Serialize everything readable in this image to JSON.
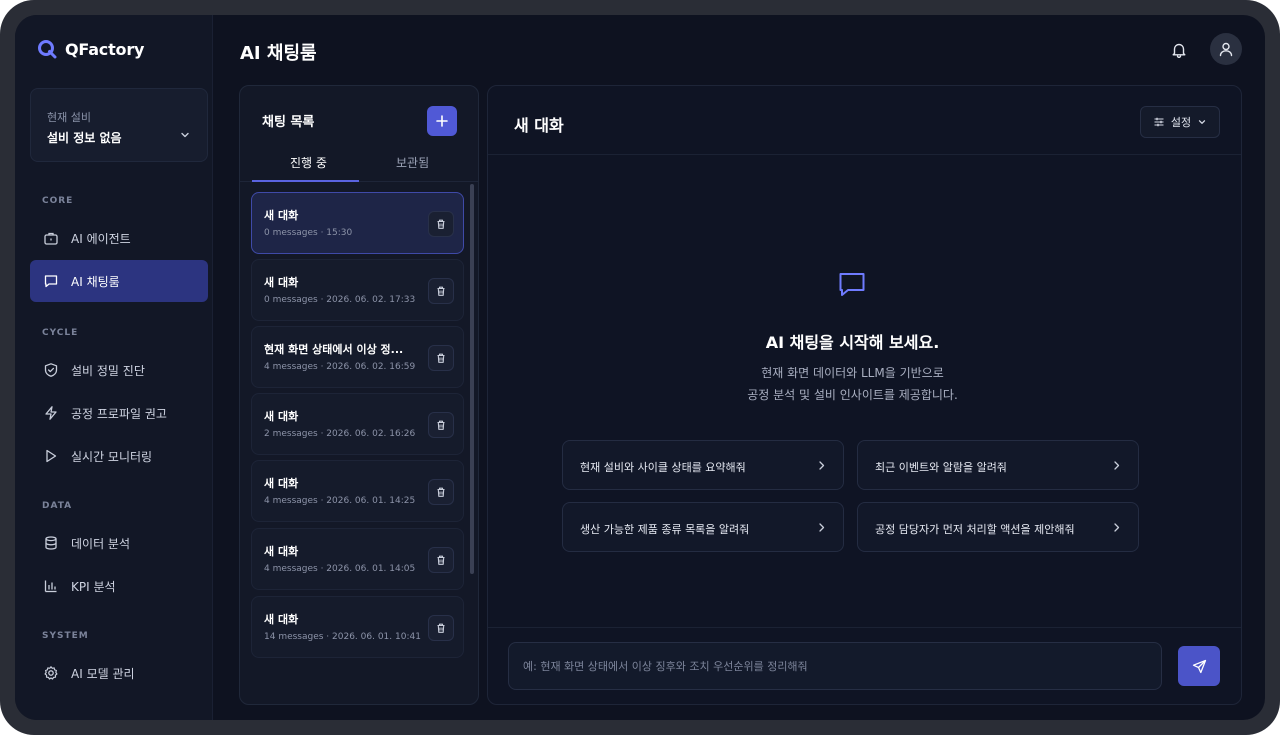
{
  "app": {
    "name": "QFactory",
    "page_title": "AI 채팅룸"
  },
  "colors": {
    "accent": "#5059d6",
    "nav_active": "#2c3480",
    "background": "#0e1220"
  },
  "sidebar": {
    "equipment": {
      "label": "현재 설비",
      "value": "설비 정보 없음"
    },
    "sections": [
      {
        "label": "CORE",
        "items": [
          {
            "label": "AI 에이전트",
            "icon": "briefcase-icon"
          },
          {
            "label": "AI 채팅룸",
            "icon": "message-square-icon",
            "active": true
          }
        ]
      },
      {
        "label": "CYCLE",
        "items": [
          {
            "label": "설비 정밀 진단",
            "icon": "shield-check-icon"
          },
          {
            "label": "공정 프로파일 권고",
            "icon": "zap-icon"
          },
          {
            "label": "실시간 모니터링",
            "icon": "play-icon"
          }
        ]
      },
      {
        "label": "DATA",
        "items": [
          {
            "label": "데이터 분석",
            "icon": "database-icon"
          },
          {
            "label": "KPI 분석",
            "icon": "bar-chart-icon"
          }
        ]
      },
      {
        "label": "SYSTEM",
        "items": [
          {
            "label": "AI 모델 관리",
            "icon": "gear-icon"
          }
        ]
      }
    ]
  },
  "chat_list": {
    "title": "채팅 목록",
    "tabs": [
      {
        "label": "진행 중",
        "active": true
      },
      {
        "label": "보관됨"
      }
    ],
    "items": [
      {
        "name": "새 대화",
        "meta": "0 messages · 15:30",
        "active": true
      },
      {
        "name": "새 대화",
        "meta": "0 messages · 2026. 06. 02. 17:33"
      },
      {
        "name": "현재 화면 상태에서 이상 정...",
        "meta": "4 messages · 2026. 06. 02. 16:59"
      },
      {
        "name": "새 대화",
        "meta": "2 messages · 2026. 06. 02. 16:26"
      },
      {
        "name": "새 대화",
        "meta": "4 messages · 2026. 06. 01. 14:25"
      },
      {
        "name": "새 대화",
        "meta": "4 messages · 2026. 06. 01. 14:05"
      },
      {
        "name": "새 대화",
        "meta": "14 messages · 2026. 06. 01. 10:41"
      }
    ]
  },
  "main": {
    "title": "새 대화",
    "settings_label": "설정",
    "empty": {
      "title": "AI 채팅을 시작해 보세요.",
      "desc_line1": "현재 화면 데이터와 LLM을 기반으로",
      "desc_line2": "공정 분석 및 설비 인사이트를 제공합니다."
    },
    "suggestions": [
      "현재 설비와 사이클 상태를 요약해줘",
      "최근 이벤트와 알람을 알려줘",
      "생산 가능한 제품 종류 목록을 알려줘",
      "공정 담당자가 먼저 처리할 액션을 제안해줘"
    ],
    "input_placeholder": "예: 현재 화면 상태에서 이상 징후와 조치 우선순위를 정리해줘"
  }
}
